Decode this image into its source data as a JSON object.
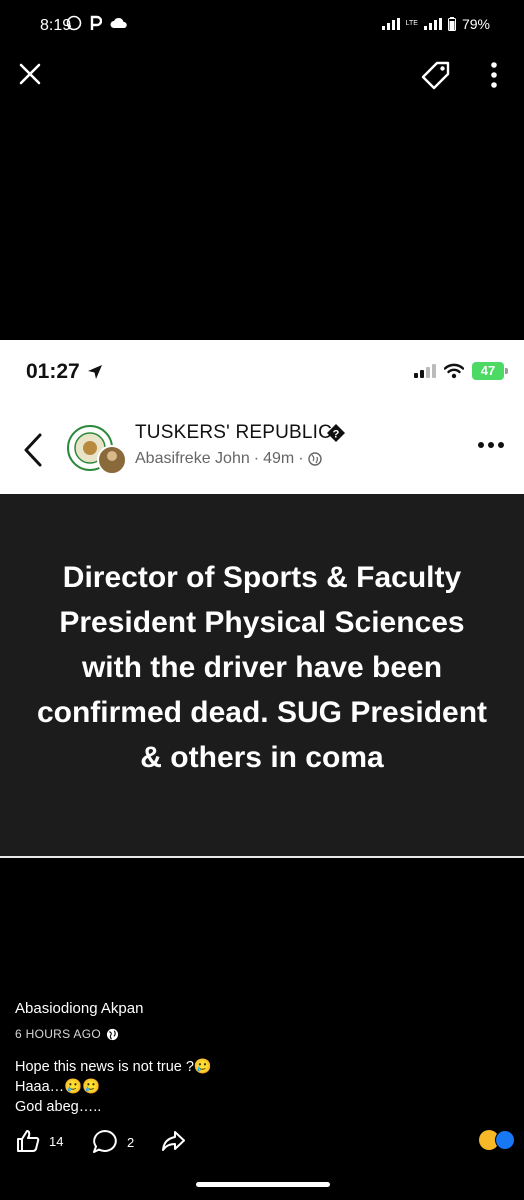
{
  "status_bar": {
    "time": "8:19",
    "battery": "79%",
    "network": "LTE"
  },
  "viewer": {
    "icons": [
      "close-icon",
      "tag-icon",
      "more-vertical-icon"
    ]
  },
  "screenshot": {
    "status": {
      "time": "01:27",
      "battery": "47"
    },
    "header": {
      "group_name": "TUSKERS' REPUBLIC.",
      "author": "Abasifreke John",
      "time": "49m",
      "separator": "·"
    },
    "post_text": "Director of Sports & Faculty President Physical Sciences with the driver have been confirmed dead. SUG President & others in coma"
  },
  "comment": {
    "author": "Abasiodiong Akpan",
    "time": "6 HOURS AGO",
    "lines": [
      "Hope this news  is not true ?🥲",
      "Haaa…🥲🥲",
      "God abeg….."
    ]
  },
  "actions": {
    "likes": "14",
    "comments": "2"
  },
  "colors": {
    "background": "#000000",
    "post_background": "#1c1c1c",
    "ios_battery": "#4cd964",
    "like_blue": "#1877f2"
  }
}
